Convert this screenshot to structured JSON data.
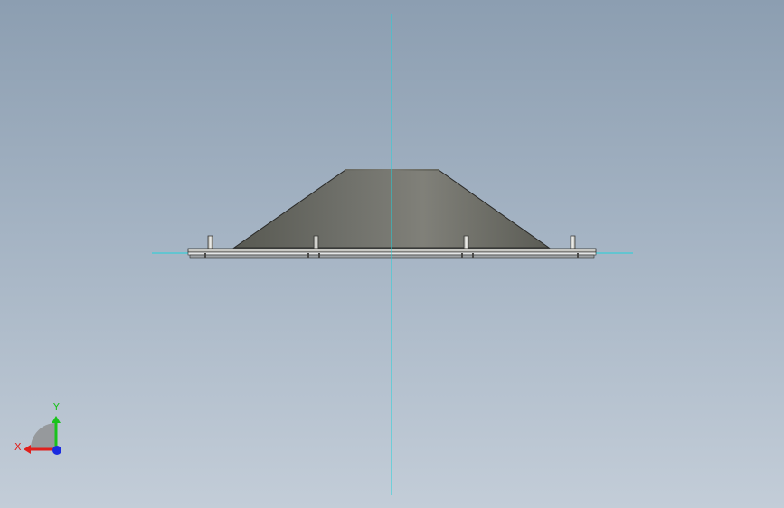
{
  "viewport": {
    "background_top": "#8c9eb1",
    "background_bottom": "#c3cdd8",
    "centerline_color": "#1fd3dc",
    "model": {
      "name": "conical-cover-with-pins",
      "body_color": "#6e6e66",
      "plate_color": "#b8b8b2",
      "pin_count": 4
    }
  },
  "triad": {
    "x_label": "X",
    "y_label": "Y",
    "x_color": "#e0201c",
    "y_color": "#19c21b",
    "z_color": "#1a2be0"
  }
}
